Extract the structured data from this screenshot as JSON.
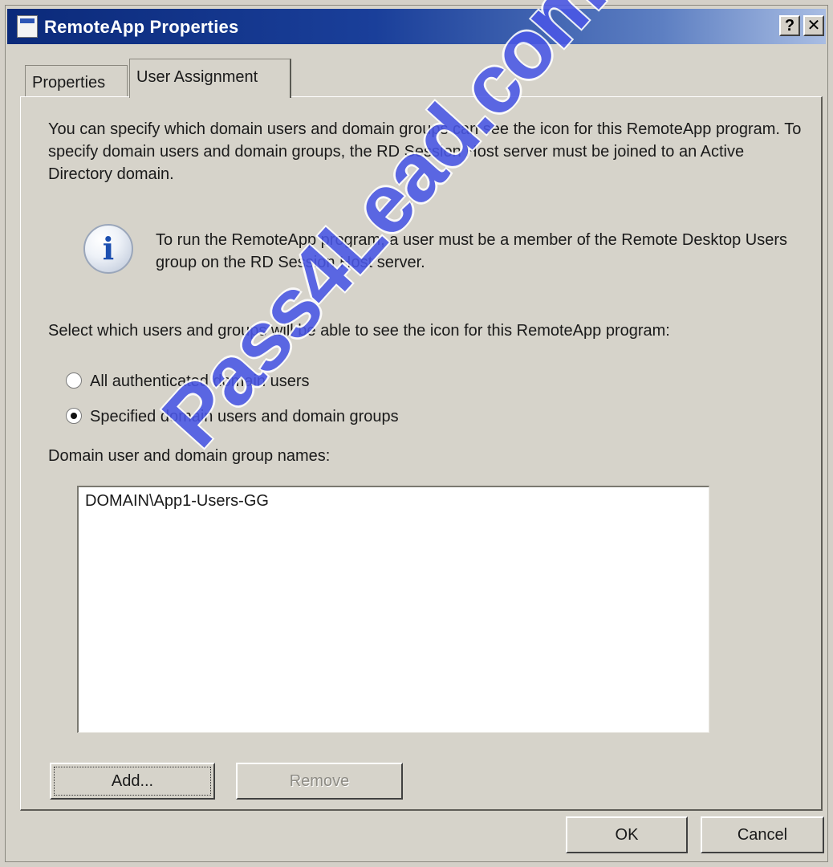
{
  "window": {
    "title": "RemoteApp Properties",
    "help_label": "?",
    "close_label": "✕"
  },
  "tabs": [
    {
      "label": "Properties",
      "active": false
    },
    {
      "label": "User Assignment",
      "active": true
    }
  ],
  "panel": {
    "description": "You can specify which domain users and domain groups can see the icon for this RemoteApp program. To specify domain users and domain groups, the RD Session Host server must be joined to an Active Directory domain.",
    "info_icon": "info-icon",
    "info_text": "To run the RemoteApp program, a user must be a member of the Remote Desktop Users group on the RD Session Host server.",
    "select_label": "Select which users and groups will be able to see the icon for this RemoteApp program:",
    "radio_options": [
      {
        "label": "All authenticated domain users",
        "selected": false
      },
      {
        "label": "Specified domain users and domain groups",
        "selected": true
      }
    ],
    "list_label": "Domain user and domain group names:",
    "list_items": [
      "DOMAIN\\App1-Users-GG"
    ],
    "add_button": "Add...",
    "remove_button": "Remove"
  },
  "footer": {
    "ok_button": "OK",
    "cancel_button": "Cancel"
  },
  "watermark": "Pass4Lead.com",
  "colors": {
    "title_bar": "#0b2a7a",
    "dialog_bg": "#d6d3ca",
    "watermark": "#4a57e6"
  }
}
